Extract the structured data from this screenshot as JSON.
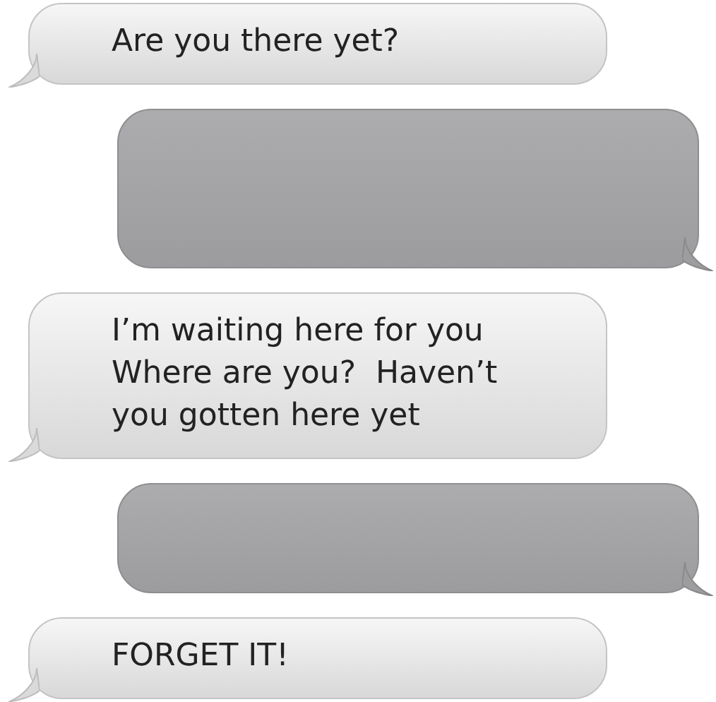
{
  "messages": [
    {
      "kind": "incoming",
      "text": "Are you there yet?"
    },
    {
      "kind": "tallout"
    },
    {
      "kind": "incoming",
      "text": "I’m waiting here for you\nWhere are you?  Haven’t\nyou gotten here yet"
    },
    {
      "kind": "outgoing"
    },
    {
      "kind": "incoming",
      "text": "FORGET IT!"
    }
  ]
}
